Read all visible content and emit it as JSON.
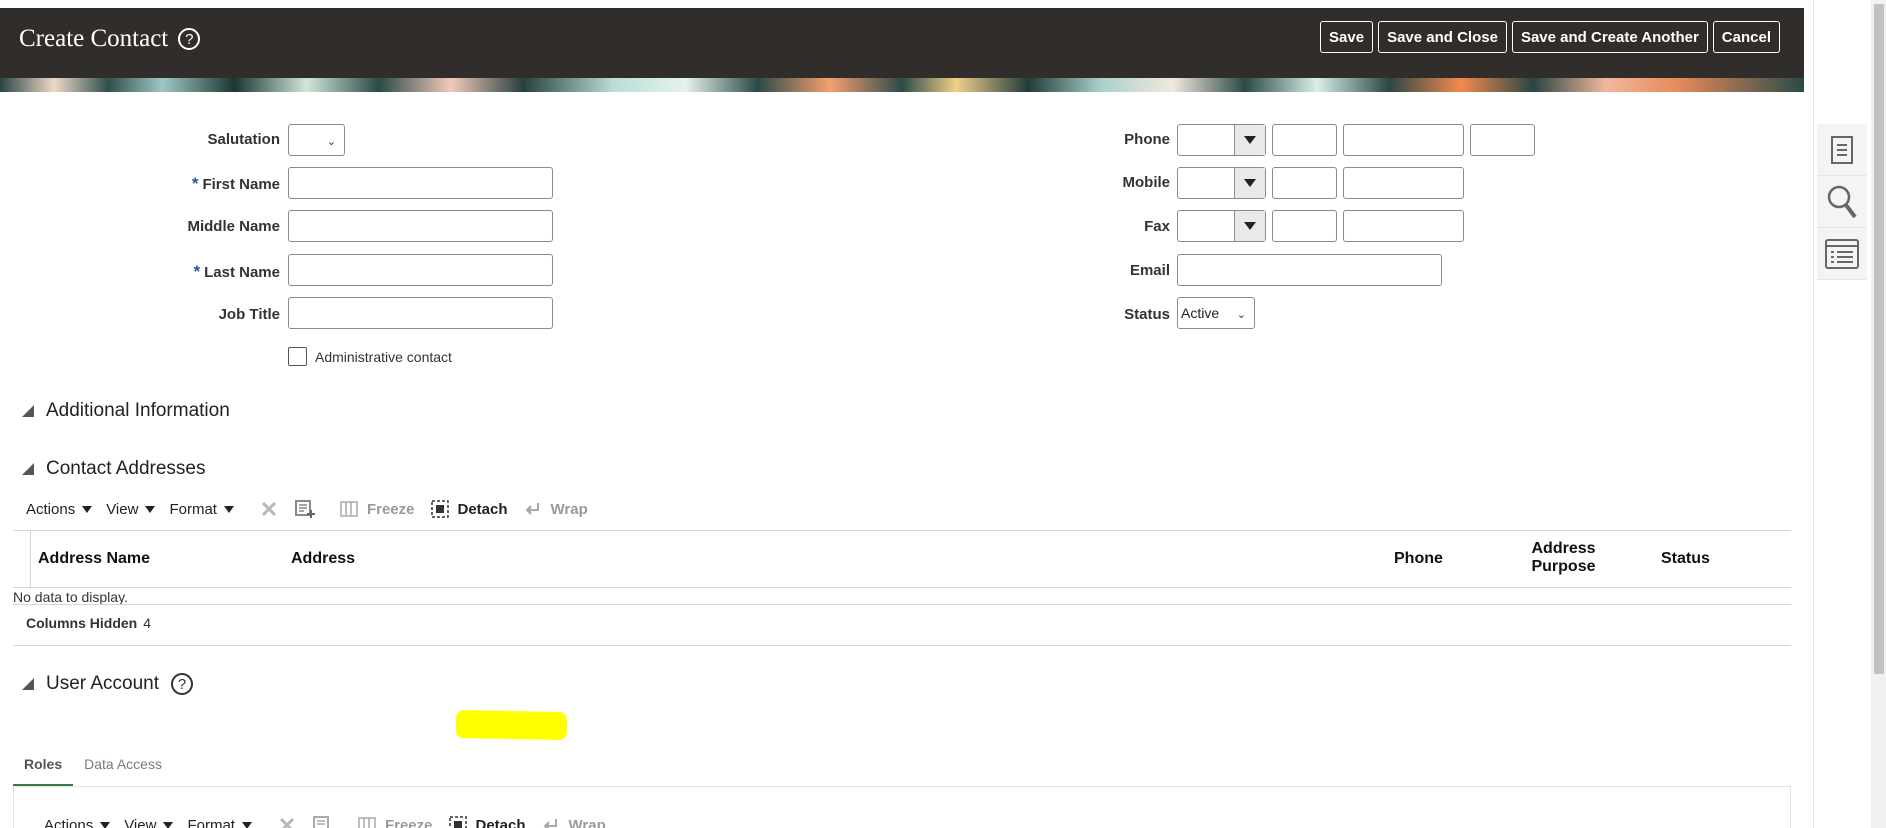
{
  "header": {
    "title": "Create Contact",
    "buttons": {
      "save": "Save",
      "save_close": "Save and Close",
      "save_create_another": "Save and Create Another",
      "cancel": "Cancel"
    }
  },
  "form_left": {
    "salutation_label": "Salutation",
    "salutation_value": "",
    "first_name_label": "First Name",
    "middle_name_label": "Middle Name",
    "last_name_label": "Last Name",
    "job_title_label": "Job Title",
    "admin_contact_label": "Administrative contact",
    "admin_contact_checked": false
  },
  "form_right": {
    "phone_label": "Phone",
    "mobile_label": "Mobile",
    "fax_label": "Fax",
    "email_label": "Email",
    "status_label": "Status",
    "status_value": "Active"
  },
  "sections": {
    "additional_info": "Additional Information",
    "contact_addresses": "Contact Addresses",
    "user_account": "User Account"
  },
  "toolbar": {
    "actions": "Actions",
    "view": "View",
    "format": "Format",
    "freeze": "Freeze",
    "detach": "Detach",
    "wrap": "Wrap"
  },
  "addresses_table": {
    "columns": [
      "Address Name",
      "Address",
      "Phone",
      "Address Purpose",
      "Status"
    ],
    "empty_text": "No data to display.",
    "columns_hidden_label": "Columns Hidden",
    "columns_hidden_count": "4"
  },
  "user_account_tabs": {
    "roles": "Roles",
    "data_access": "Data Access"
  },
  "icons": {
    "help": "question-circle-icon",
    "side_panel": [
      "document-icon",
      "search-icon",
      "list-icon"
    ]
  },
  "colors": {
    "header_bg": "#312d2a",
    "required_star": "#1b5aa6",
    "active_tab": "#3a7a4a",
    "highlight": "#ffff00"
  }
}
